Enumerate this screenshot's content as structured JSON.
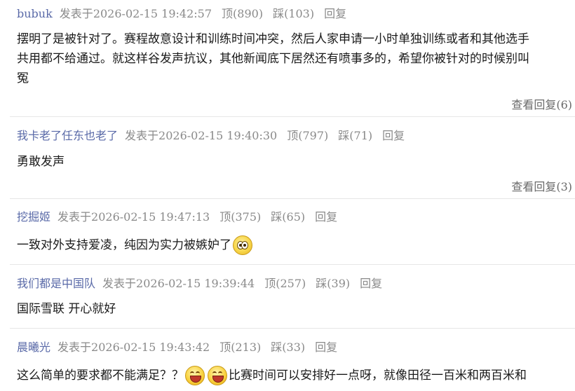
{
  "labels": {
    "posted_prefix": "发表于",
    "up": "顶",
    "down": "踩",
    "reply": "回复",
    "view_replies": "查看回复"
  },
  "comments": [
    {
      "user": "bubuk",
      "timestamp": "2026-02-15 19:42:57",
      "up_count": "(890)",
      "down_count": "(103)",
      "text_lines": [
        "摆明了是被针对了。赛程故意设计和训练时间冲突，然后人家申请一小时单独训练或者和其他选手",
        "共用都不给通过。就这样谷发声抗议，其他新闻底下居然还有喷事多的，希望你被针对的时候别叫",
        "冤"
      ],
      "view_replies_count": "(6)"
    },
    {
      "user": "我卡老了任东也老了",
      "timestamp": "2026-02-15 19:40:30",
      "up_count": "(797)",
      "down_count": "(71)",
      "text_lines": [
        "勇敢发声"
      ],
      "view_replies_count": "(3)"
    },
    {
      "user": "挖掘姬",
      "timestamp": "2026-02-15 19:47:13",
      "up_count": "(375)",
      "down_count": "(65)",
      "text_lines": [
        "一致对外支持爱凌，纯因为实力被嫉妒了"
      ],
      "emoji": "wide-eyes-emoji"
    },
    {
      "user": "我们都是中国队",
      "timestamp": "2026-02-15 19:39:44",
      "up_count": "(257)",
      "down_count": "(39)",
      "text_lines": [
        "国际雪联 开心就好"
      ]
    },
    {
      "user": "晨曦光",
      "timestamp": "2026-02-15 19:43:42",
      "up_count": "(213)",
      "down_count": "(33)",
      "text_lines_a": "这么简单的要求都不能满足？？",
      "text_lines_b": "比赛时间可以安排好一点呀，就像田径一百米和两百米和",
      "emoji": "grin-emoji"
    }
  ]
}
